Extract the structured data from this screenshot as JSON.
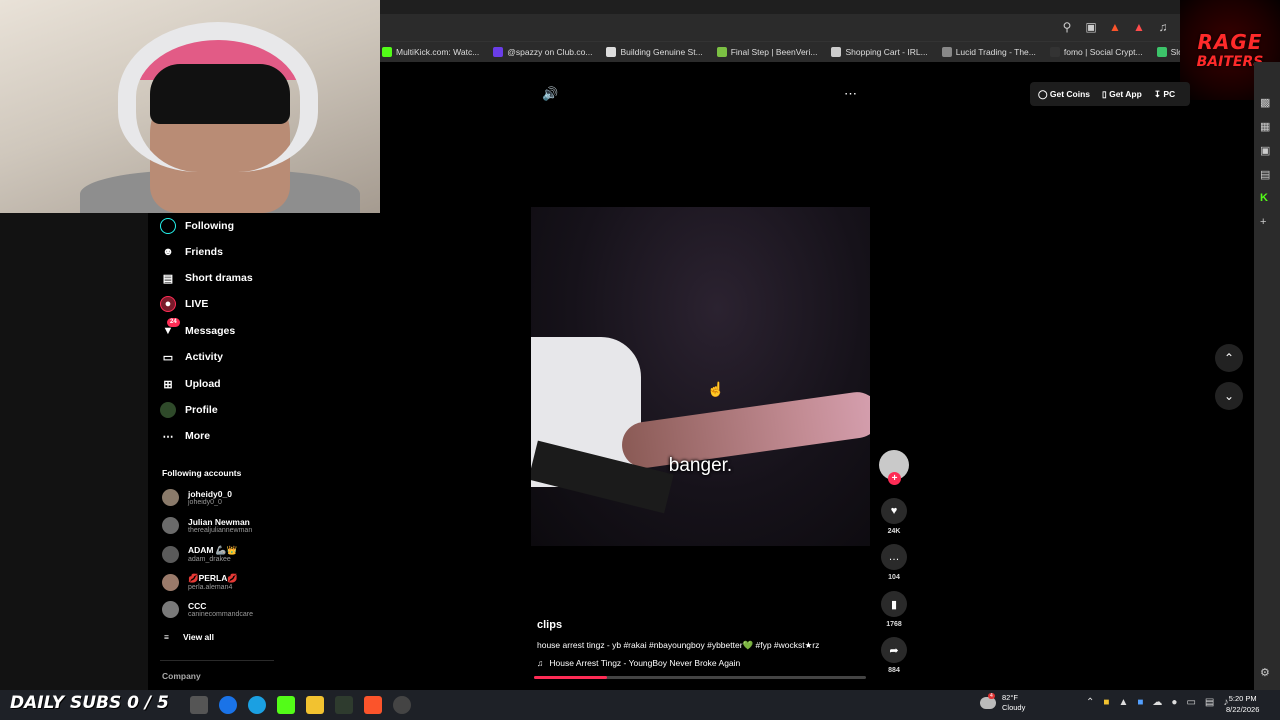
{
  "bookmarks": [
    {
      "label": "MultiKick.com: Watc...",
      "color": "#53fc18"
    },
    {
      "label": "@spazzy on Club.co...",
      "color": "#6a3de8"
    },
    {
      "label": "Building Genuine St...",
      "color": "#dddddd"
    },
    {
      "label": "Final Step | BeenVeri...",
      "color": "#7bc043"
    },
    {
      "label": "Shopping Cart - IRL...",
      "color": "#cccccc"
    },
    {
      "label": "Lucid Trading - The...",
      "color": "#888888"
    },
    {
      "label": "fomo | Social Crypt...",
      "color": "#333333"
    },
    {
      "label": "Slope Game",
      "color": "#3cc46a"
    }
  ],
  "top_actions": {
    "get_coins": "Get Coins",
    "get_app": "Get App",
    "pc": "PC"
  },
  "nav": {
    "following": "Following",
    "friends": "Friends",
    "short_dramas": "Short dramas",
    "live": "LIVE",
    "messages": "Messages",
    "messages_badge": "24",
    "activity": "Activity",
    "upload": "Upload",
    "profile": "Profile",
    "more": "More"
  },
  "following_title": "Following accounts",
  "accounts": [
    {
      "display": "joheidy0_0",
      "user": "joheidy0_0"
    },
    {
      "display": "Julian Newman",
      "user": "therealjuliannewman"
    },
    {
      "display": "ADAM 🦾👑",
      "user": "adam_drakee"
    },
    {
      "display": "💋PERLA💋",
      "user": "perla.aleman4"
    },
    {
      "display": "CCC",
      "user": "caninecommandcare"
    }
  ],
  "view_all": "View all",
  "company": "Company",
  "video": {
    "caption": "banger.",
    "author": "clips",
    "description": "house arrest tingz - yb #rakai #nbayoungboy #ybbetter💚 #fyp #wockst★rz",
    "music": "House Arrest Tingz - YoungBoy Never Broke Again",
    "progress": 0.22
  },
  "stats": {
    "likes": "24K",
    "comments": "104",
    "saves": "1768",
    "shares": "884"
  },
  "overlay": {
    "subs": "DAILY SUBS 0 / 5",
    "logo_top": "RAGE",
    "logo_bottom": "BAITERS"
  },
  "taskbar": {
    "weather_temp": "82°F",
    "weather_cond": "Cloudy",
    "weather_badge": "4",
    "time": "5:20 PM",
    "date": "8/22/2026"
  }
}
